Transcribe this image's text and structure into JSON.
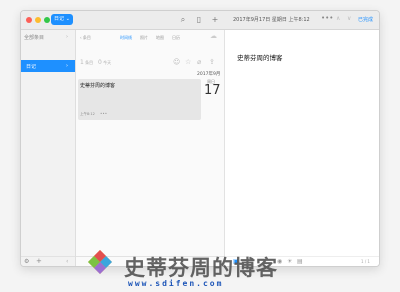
{
  "titlebar": {
    "journal_label": "日记",
    "journal_chevron": "⌄",
    "search_icon": "⌕",
    "layout_icon": "▯",
    "add_icon": "+",
    "date": "2017年9月17日 星期日 上午8:12",
    "more": "•••",
    "up": "∧",
    "down": "∨",
    "done": "已完成"
  },
  "sidebar": {
    "all_label": "全部条目",
    "all_chevron": "›",
    "selected_label": "日记",
    "selected_chevron": "›",
    "footer": {
      "gear": "⚙",
      "plus": "+",
      "back": "‹"
    }
  },
  "list": {
    "tabs": [
      {
        "label": "‹ 条目",
        "active": false
      },
      {
        "label": "时间线",
        "active": true
      },
      {
        "label": "照片",
        "active": false
      },
      {
        "label": "地图",
        "active": false
      },
      {
        "label": "日历",
        "active": false
      }
    ],
    "counts": [
      {
        "number": "1",
        "unit": "条目"
      },
      {
        "number": "0",
        "unit": "今天"
      }
    ],
    "tool_icons": [
      "☺",
      "☆",
      "⌀",
      "⇪"
    ],
    "month": "2017年9月",
    "entry": {
      "title": "史蒂芬周的博客",
      "time": "上午8:12",
      "more": "•••",
      "weekday": "周日",
      "day": "17"
    }
  },
  "editor": {
    "title": "史蒂芬周的博客",
    "footer": {
      "icons": [
        "▣",
        "◉",
        "☀",
        "▤"
      ],
      "page": "1 / 1"
    }
  },
  "watermark": {
    "name": "史蒂芬周的博客",
    "url": "www.sdifen.com"
  }
}
